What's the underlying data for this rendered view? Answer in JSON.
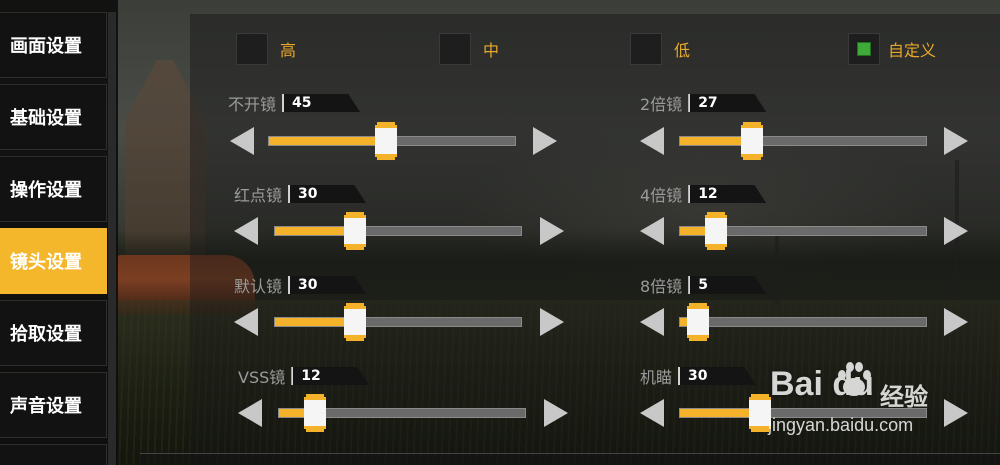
{
  "sidebar": {
    "items": [
      {
        "label": "画面设置",
        "active": false
      },
      {
        "label": "基础设置",
        "active": false
      },
      {
        "label": "操作设置",
        "active": false
      },
      {
        "label": "镜头设置",
        "active": true
      },
      {
        "label": "拾取设置",
        "active": false
      },
      {
        "label": "声音设置",
        "active": false
      }
    ]
  },
  "presets": {
    "high": {
      "label": "高",
      "checked": false
    },
    "medium": {
      "label": "中",
      "checked": false
    },
    "low": {
      "label": "低",
      "checked": false
    },
    "custom": {
      "label": "自定义",
      "checked": true
    }
  },
  "sliders": [
    {
      "name": "不开镜",
      "value": "45",
      "fraction": 0.45
    },
    {
      "name": "2倍镜",
      "value": "27",
      "fraction": 0.27
    },
    {
      "name": "红点镜",
      "value": "30",
      "fraction": 0.3
    },
    {
      "name": "4倍镜",
      "value": "12",
      "fraction": 0.12
    },
    {
      "name": "默认镜",
      "value": "30",
      "fraction": 0.3
    },
    {
      "name": "8倍镜",
      "value": "5",
      "fraction": 0.05
    },
    {
      "name": "VSS镜",
      "value": "12",
      "fraction": 0.12
    },
    {
      "name": "机瞄",
      "value": "30",
      "fraction": 0.3
    }
  ],
  "watermark": {
    "logo": "Bai du",
    "cn": "经验",
    "url": "jingyan.baidu.com"
  },
  "colors": {
    "accent": "#f4b62a",
    "check": "#3faa3a",
    "label": "#e8a82a"
  }
}
